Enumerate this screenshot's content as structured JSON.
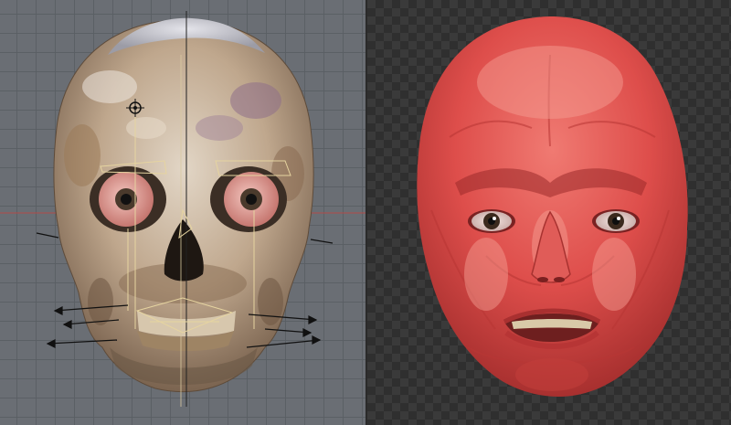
{
  "left_viewport": {
    "name": "skull-rig-viewport",
    "background": "#6a6e74",
    "grid_color": "#5a5e64",
    "axis_x_color": "#c0504d",
    "axis_y_color": "#222222",
    "skull_color": "#c9b9a6",
    "skull_shadow": "#6b5a48",
    "cranium_cap_color": "#c5c5cc",
    "eye_sclera": "#e9a9a2",
    "eye_iris": "#4a3a2c",
    "rig_line_color": "#e6d4a0"
  },
  "right_viewport": {
    "name": "muscle-head-viewport",
    "checker_a": "#3a3a3a",
    "checker_b": "#2f2f2f",
    "muscle_color": "#e0514f",
    "muscle_dark": "#a8302f",
    "muscle_light": "#f08a80",
    "eye_iris": "#3b2a1e"
  }
}
